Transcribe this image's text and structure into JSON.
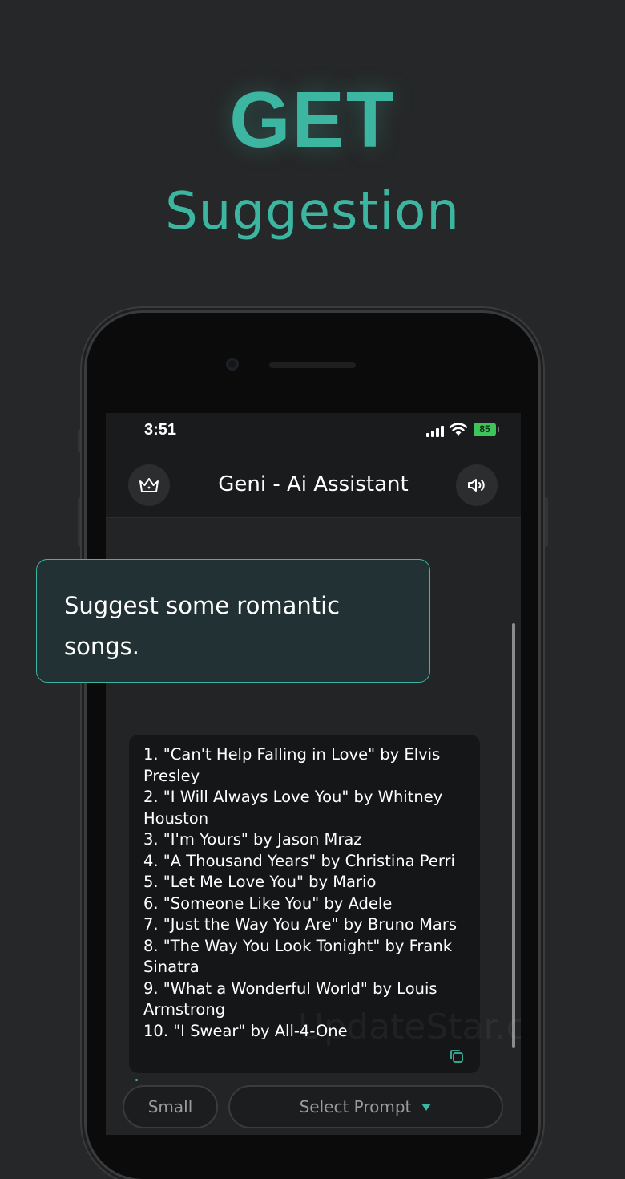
{
  "hero": {
    "title": "GET",
    "subtitle": "Suggestion"
  },
  "status_bar": {
    "time": "3:51",
    "battery": "85"
  },
  "header": {
    "title": "Geni - Ai Assistant",
    "left_icon": "crown-icon",
    "right_icon": "speaker-icon"
  },
  "prompt": {
    "text": "Suggest some romantic songs."
  },
  "reply": {
    "lines": [
      "1. \"Can't Help Falling in Love\" by Elvis",
      "Presley",
      "2. \"I Will Always Love You\" by Whitney",
      "Houston",
      "3. \"I'm Yours\" by Jason Mraz",
      "4. \"A Thousand Years\" by Christina Perri",
      "5. \"Let Me Love You\" by Mario",
      "6. \"Someone Like You\" by Adele",
      "7. \"Just the Way You Are\" by Bruno Mars",
      "8. \"The Way You Look Tonight\" by Frank",
      "Sinatra",
      "9. \"What a Wonderful World\" by Louis",
      "Armstrong",
      "10. \"I Swear\" by All-4-One"
    ],
    "copy_icon": "copy-icon"
  },
  "watermark": "UpdateStar.com",
  "bottom": {
    "size_label": "Small",
    "prompt_label": "Select Prompt"
  },
  "colors": {
    "accent": "#3cb5a1",
    "background": "#262728",
    "battery": "#3ec55a"
  }
}
